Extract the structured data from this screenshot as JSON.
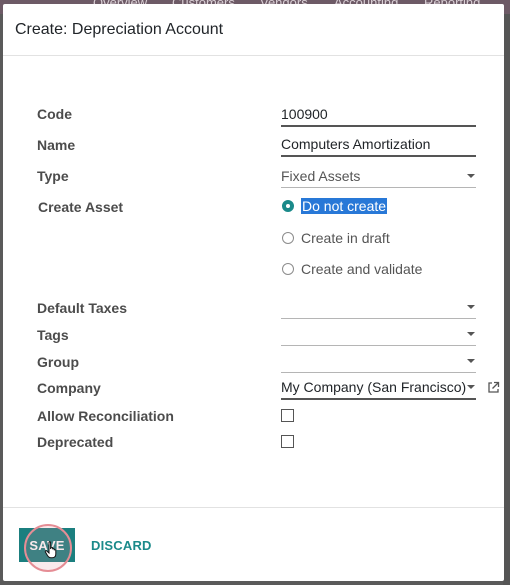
{
  "background": {
    "nav_items": [
      "Overview",
      "Customers",
      "Vendors",
      "Accounting",
      "Reporting"
    ]
  },
  "modal": {
    "title": "Create: Depreciation Account"
  },
  "form": {
    "code": {
      "label": "Code",
      "value": "100900"
    },
    "name": {
      "label": "Name",
      "value": "Computers Amortization"
    },
    "type": {
      "label": "Type",
      "value": "Fixed Assets"
    },
    "create_asset": {
      "label": "Create Asset",
      "options": [
        "Do not create",
        "Create in draft",
        "Create and validate"
      ],
      "selected": "Do not create"
    },
    "default_taxes": {
      "label": "Default Taxes",
      "value": ""
    },
    "tags": {
      "label": "Tags",
      "value": ""
    },
    "group": {
      "label": "Group",
      "value": ""
    },
    "company": {
      "label": "Company",
      "value": "My Company (San Francisco)"
    },
    "allow_reconciliation": {
      "label": "Allow Reconciliation",
      "checked": false
    },
    "deprecated": {
      "label": "Deprecated",
      "checked": false
    }
  },
  "footer": {
    "save_label": "SAVE",
    "discard_label": "DISCARD"
  },
  "colors": {
    "accent": "#1b7f7f",
    "selection": "#2878d7",
    "click_highlight": "#e58d95"
  },
  "icons": {
    "external_link": "external-link-icon",
    "dropdown": "caret-down-icon",
    "cursor": "hand-pointer-icon"
  }
}
